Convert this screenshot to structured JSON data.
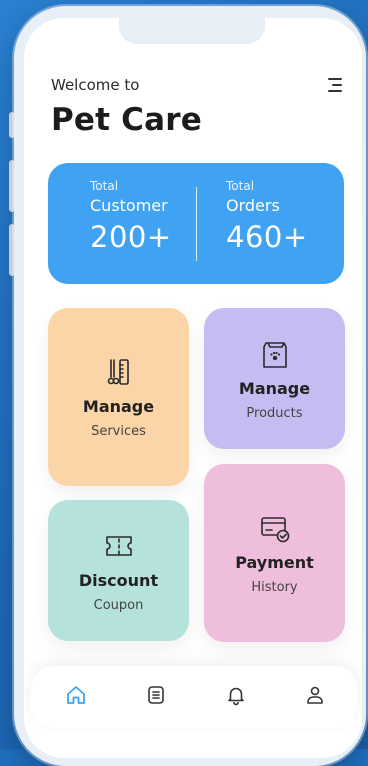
{
  "header": {
    "welcome": "Welcome to",
    "title": "Pet Care",
    "menu_icon": "menu-icon"
  },
  "stats": {
    "customer": {
      "label": "Total",
      "name": "Customer",
      "value": "200+"
    },
    "orders": {
      "label": "Total",
      "name": "Orders",
      "value": "460+"
    },
    "color": "#3fa2f3"
  },
  "cards": {
    "services": {
      "title": "Manage",
      "subtitle": "Services",
      "icon": "grooming-tools-icon",
      "color": "#fbd5a7"
    },
    "products": {
      "title": "Manage",
      "subtitle": "Products",
      "icon": "pet-food-bag-icon",
      "color": "#c4bdf1"
    },
    "payment": {
      "title": "Payment",
      "subtitle": "History",
      "icon": "card-check-icon",
      "color": "#f0bedd"
    },
    "discount": {
      "title": "Discount",
      "subtitle": "Coupon",
      "icon": "ticket-icon",
      "color": "#b5e3dc"
    }
  },
  "tabbar": {
    "items": [
      {
        "icon": "home-icon",
        "active": true
      },
      {
        "icon": "list-icon",
        "active": false
      },
      {
        "icon": "bell-icon",
        "active": false
      },
      {
        "icon": "user-icon",
        "active": false
      }
    ],
    "active_color": "#3fa2f3"
  }
}
